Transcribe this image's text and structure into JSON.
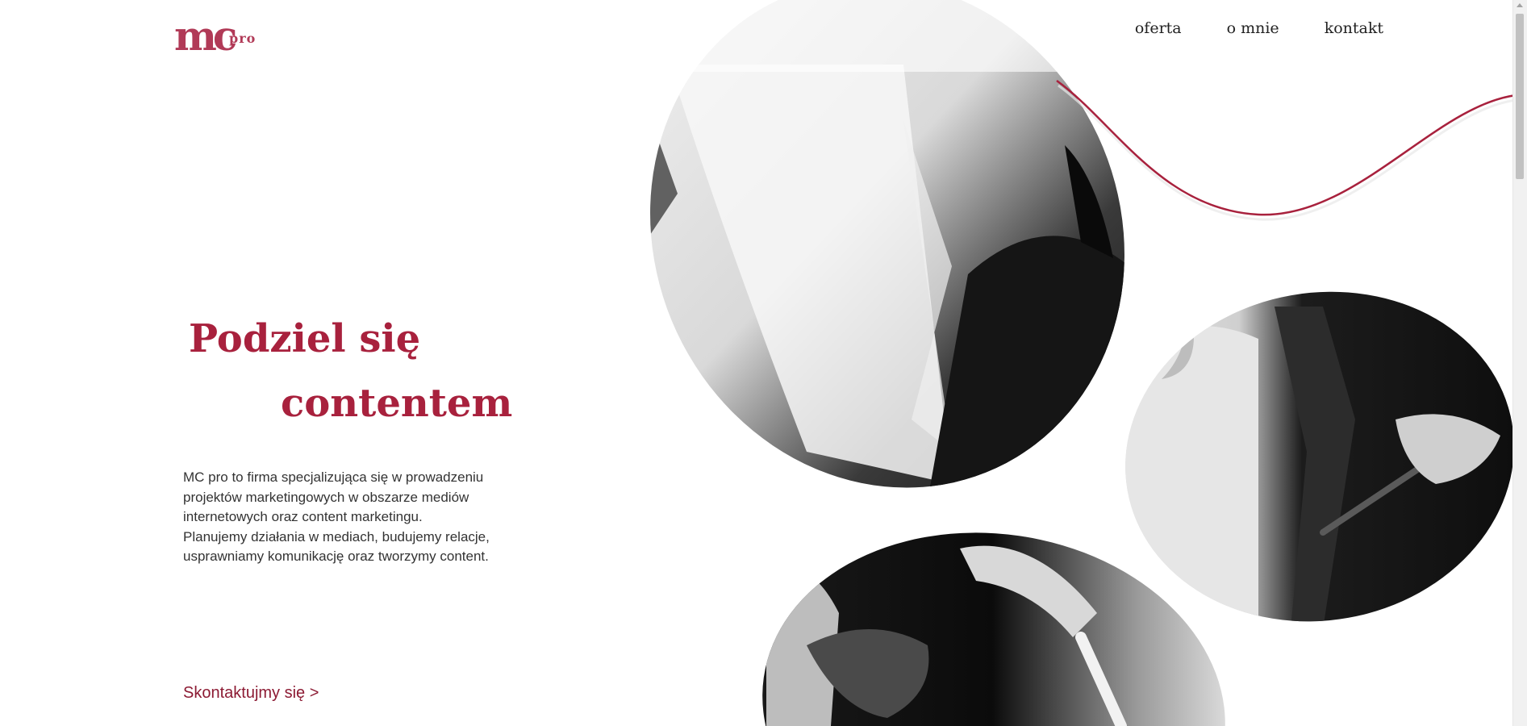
{
  "brand": {
    "logo_main": "mc",
    "logo_sub": "pro",
    "accent_color": "#a8213d",
    "logo_color": "#b13a57"
  },
  "nav": {
    "items": [
      {
        "label": "oferta"
      },
      {
        "label": "o mnie"
      },
      {
        "label": "kontakt"
      }
    ]
  },
  "hero": {
    "title_line1": "Podziel się",
    "title_line2": "contentem",
    "description": "MC pro to firma specjalizująca się w prowadzeniu projektów marketingowych w obszarze mediów internetowych oraz content marketingu. Planujemy działania w mediach, budujemy relacje, usprawniamy komunikację oraz tworzymy content.",
    "cta_label": "Skontaktujmy się >"
  },
  "decor": {
    "photo_style": "black-and-white",
    "wave_color": "#a8213d"
  }
}
